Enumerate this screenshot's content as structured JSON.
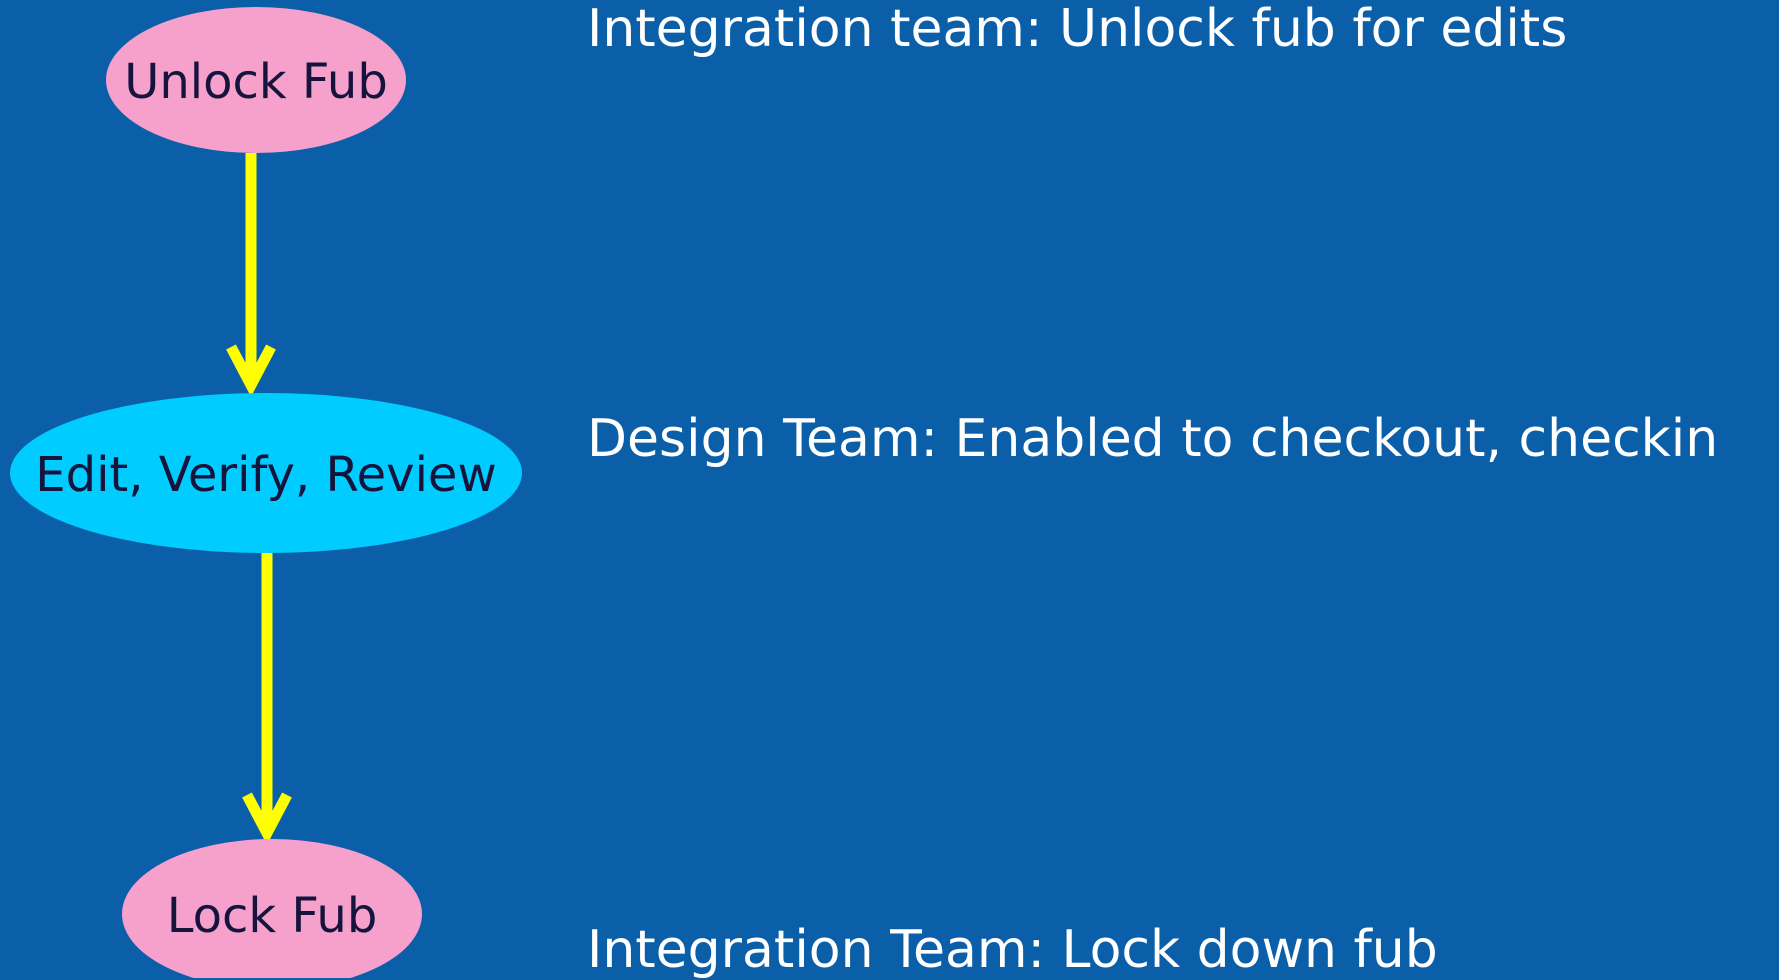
{
  "colors": {
    "background": "#0a5fa8",
    "terminal_node_fill": "#f6a0cc",
    "process_node_fill": "#00ccff",
    "arrow": "#ffff00",
    "node_text": "#14143c",
    "description_text": "#ffffff"
  },
  "nodes": [
    {
      "id": "unlock",
      "label": "Unlock Fub",
      "shape": "ellipse"
    },
    {
      "id": "edit",
      "label": "Edit, Verify, Review",
      "shape": "ellipse"
    },
    {
      "id": "lock",
      "label": "Lock Fub",
      "shape": "ellipse"
    }
  ],
  "edges": [
    {
      "from": "unlock",
      "to": "edit"
    },
    {
      "from": "edit",
      "to": "lock"
    }
  ],
  "descriptions": [
    "Integration team: Unlock fub for edits",
    "Design Team: Enabled to checkout, checkin",
    "Integration Team: Lock down fub"
  ]
}
